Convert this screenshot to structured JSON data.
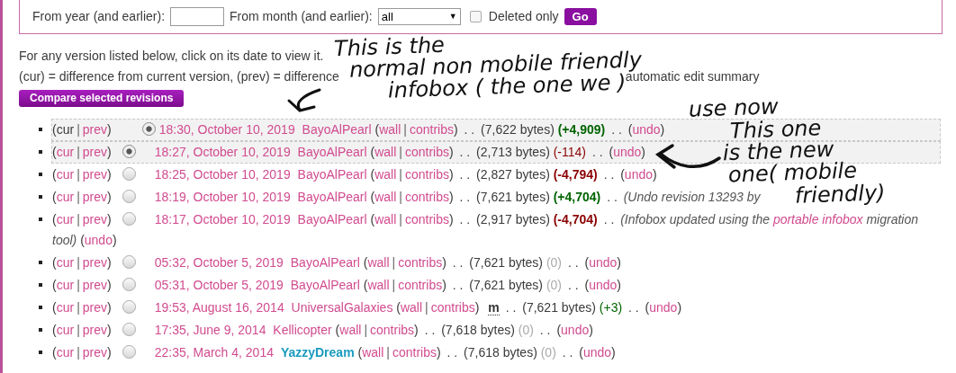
{
  "filter": {
    "year_label": "From year (and earlier):",
    "month_label": "From month (and earlier):",
    "month_value": "all",
    "month_caret": "▼",
    "deleted_label": "Deleted only",
    "deleted_checked": false,
    "go": "Go"
  },
  "intro": "For any version listed below, click on its date to view it.",
  "legend": "(cur) = difference from current version, (prev) = difference",
  "legend_tail": "automatic edit summary",
  "compare_button": "Compare selected revisions",
  "rows": [
    {
      "kind": "current",
      "selected": true,
      "radio_checked": true,
      "before": [
        {
          "text": "(",
          "kind": "open"
        },
        {
          "text": "cur",
          "kind": "plain"
        },
        {
          "text": "|",
          "kind": "sep"
        },
        {
          "text": "prev",
          "kind": "link"
        },
        {
          "text": ")",
          "kind": "close"
        }
      ],
      "after": [
        {
          "text": "18:30, October 10, 2019",
          "kind": "date"
        },
        {
          "text": "BayoAlPearl",
          "kind": "user"
        },
        {
          "text": "(",
          "kind": "open"
        },
        {
          "text": "wall",
          "kind": "link"
        },
        {
          "text": "|",
          "kind": "sep"
        },
        {
          "text": "contribs",
          "kind": "link"
        },
        {
          "text": ")",
          "kind": "close"
        },
        {
          "text": ". .",
          "kind": "dots"
        },
        {
          "text": "(7,622 bytes)",
          "kind": "size"
        },
        {
          "text": "(+4,909)",
          "kind": "diff_big_plus"
        },
        {
          "text": ". .",
          "kind": "dots"
        },
        {
          "text": "(",
          "kind": "open"
        },
        {
          "text": "undo",
          "kind": "link"
        },
        {
          "text": ")",
          "kind": "close"
        }
      ]
    },
    {
      "kind": "older",
      "selected": true,
      "radio_checked": true,
      "before": [
        {
          "text": "(",
          "kind": "open"
        },
        {
          "text": "cur",
          "kind": "link"
        },
        {
          "text": "|",
          "kind": "sep"
        },
        {
          "text": "prev",
          "kind": "link"
        },
        {
          "text": ")",
          "kind": "close"
        }
      ],
      "after": [
        {
          "text": "18:27, October 10, 2019",
          "kind": "date"
        },
        {
          "text": "BayoAlPearl",
          "kind": "user"
        },
        {
          "text": "(",
          "kind": "open"
        },
        {
          "text": "wall",
          "kind": "link"
        },
        {
          "text": "|",
          "kind": "sep"
        },
        {
          "text": "contribs",
          "kind": "link"
        },
        {
          "text": ")",
          "kind": "close"
        },
        {
          "text": ". .",
          "kind": "dots"
        },
        {
          "text": "(2,713 bytes)",
          "kind": "size"
        },
        {
          "text": "(-114)",
          "kind": "diff_minus"
        },
        {
          "text": ". .",
          "kind": "dots"
        },
        {
          "text": "(",
          "kind": "open"
        },
        {
          "text": "undo",
          "kind": "link"
        },
        {
          "text": ")",
          "kind": "close"
        }
      ]
    },
    {
      "kind": "older",
      "selected": false,
      "radio_checked": false,
      "before": [
        {
          "text": "(",
          "kind": "open"
        },
        {
          "text": "cur",
          "kind": "link"
        },
        {
          "text": "|",
          "kind": "sep"
        },
        {
          "text": "prev",
          "kind": "link"
        },
        {
          "text": ")",
          "kind": "close"
        }
      ],
      "after": [
        {
          "text": "18:25, October 10, 2019",
          "kind": "date"
        },
        {
          "text": "BayoAlPearl",
          "kind": "user"
        },
        {
          "text": "(",
          "kind": "open"
        },
        {
          "text": "wall",
          "kind": "link"
        },
        {
          "text": "|",
          "kind": "sep"
        },
        {
          "text": "contribs",
          "kind": "link"
        },
        {
          "text": ")",
          "kind": "close"
        },
        {
          "text": ". .",
          "kind": "dots"
        },
        {
          "text": "(2,827 bytes)",
          "kind": "size"
        },
        {
          "text": "(-4,794)",
          "kind": "diff_big_minus"
        },
        {
          "text": ". .",
          "kind": "dots"
        },
        {
          "text": "(",
          "kind": "open"
        },
        {
          "text": "undo",
          "kind": "link"
        },
        {
          "text": ")",
          "kind": "close"
        }
      ]
    },
    {
      "kind": "older",
      "selected": false,
      "radio_checked": false,
      "before": [
        {
          "text": "(",
          "kind": "open"
        },
        {
          "text": "cur",
          "kind": "link"
        },
        {
          "text": "|",
          "kind": "sep"
        },
        {
          "text": "prev",
          "kind": "link"
        },
        {
          "text": ")",
          "kind": "close"
        }
      ],
      "after": [
        {
          "text": "18:19, October 10, 2019",
          "kind": "date"
        },
        {
          "text": "BayoAlPearl",
          "kind": "user"
        },
        {
          "text": "(",
          "kind": "open"
        },
        {
          "text": "wall",
          "kind": "link"
        },
        {
          "text": "|",
          "kind": "sep"
        },
        {
          "text": "contribs",
          "kind": "link"
        },
        {
          "text": ")",
          "kind": "close"
        },
        {
          "text": ". .",
          "kind": "dots"
        },
        {
          "text": "(7,621 bytes)",
          "kind": "size"
        },
        {
          "text": "(+4,704)",
          "kind": "diff_big_plus"
        },
        {
          "text": ". .",
          "kind": "dots"
        },
        {
          "text": "(Undo revision 13293 by",
          "kind": "summary"
        }
      ]
    },
    {
      "kind": "older",
      "selected": false,
      "radio_checked": false,
      "before": [
        {
          "text": "(",
          "kind": "open"
        },
        {
          "text": "cur",
          "kind": "link"
        },
        {
          "text": "|",
          "kind": "sep"
        },
        {
          "text": "prev",
          "kind": "link"
        },
        {
          "text": ")",
          "kind": "close"
        }
      ],
      "after": [
        {
          "text": "18:17, October 10, 2019",
          "kind": "date"
        },
        {
          "text": "BayoAlPearl",
          "kind": "user"
        },
        {
          "text": "(",
          "kind": "open"
        },
        {
          "text": "wall",
          "kind": "link"
        },
        {
          "text": "|",
          "kind": "sep"
        },
        {
          "text": "contribs",
          "kind": "link"
        },
        {
          "text": ")",
          "kind": "close"
        },
        {
          "text": ". .",
          "kind": "dots"
        },
        {
          "text": "(2,917 bytes)",
          "kind": "size"
        },
        {
          "text": "(-4,704)",
          "kind": "diff_big_minus"
        },
        {
          "text": ". .",
          "kind": "dots"
        },
        {
          "text": "(Infobox updated using the",
          "kind": "summary"
        },
        {
          "text": "portable infobox",
          "kind": "summary_link"
        },
        {
          "text": "migration",
          "kind": "summary"
        },
        {
          "text": "tool)",
          "kind": "summary"
        },
        {
          "text": "(",
          "kind": "open"
        },
        {
          "text": "undo",
          "kind": "link"
        },
        {
          "text": ")",
          "kind": "close"
        }
      ]
    },
    {
      "kind": "older",
      "selected": false,
      "radio_checked": false,
      "before": [
        {
          "text": "(",
          "kind": "open"
        },
        {
          "text": "cur",
          "kind": "link"
        },
        {
          "text": "|",
          "kind": "sep"
        },
        {
          "text": "prev",
          "kind": "link"
        },
        {
          "text": ")",
          "kind": "close"
        }
      ],
      "after": [
        {
          "text": "05:32, October 5, 2019",
          "kind": "date"
        },
        {
          "text": "BayoAlPearl",
          "kind": "user"
        },
        {
          "text": "(",
          "kind": "open"
        },
        {
          "text": "wall",
          "kind": "link"
        },
        {
          "text": "|",
          "kind": "sep"
        },
        {
          "text": "contribs",
          "kind": "link"
        },
        {
          "text": ")",
          "kind": "close"
        },
        {
          "text": ". .",
          "kind": "dots"
        },
        {
          "text": "(7,621 bytes)",
          "kind": "size"
        },
        {
          "text": "(0)",
          "kind": "diff_zero"
        },
        {
          "text": ". .",
          "kind": "dots"
        },
        {
          "text": "(",
          "kind": "open"
        },
        {
          "text": "undo",
          "kind": "link"
        },
        {
          "text": ")",
          "kind": "close"
        }
      ]
    },
    {
      "kind": "older",
      "selected": false,
      "radio_checked": false,
      "before": [
        {
          "text": "(",
          "kind": "open"
        },
        {
          "text": "cur",
          "kind": "link"
        },
        {
          "text": "|",
          "kind": "sep"
        },
        {
          "text": "prev",
          "kind": "link"
        },
        {
          "text": ")",
          "kind": "close"
        }
      ],
      "after": [
        {
          "text": "05:31, October 5, 2019",
          "kind": "date"
        },
        {
          "text": "BayoAlPearl",
          "kind": "user"
        },
        {
          "text": "(",
          "kind": "open"
        },
        {
          "text": "wall",
          "kind": "link"
        },
        {
          "text": "|",
          "kind": "sep"
        },
        {
          "text": "contribs",
          "kind": "link"
        },
        {
          "text": ")",
          "kind": "close"
        },
        {
          "text": ". .",
          "kind": "dots"
        },
        {
          "text": "(7,621 bytes)",
          "kind": "size"
        },
        {
          "text": "(0)",
          "kind": "diff_zero"
        },
        {
          "text": ". .",
          "kind": "dots"
        },
        {
          "text": "(",
          "kind": "open"
        },
        {
          "text": "undo",
          "kind": "link"
        },
        {
          "text": ")",
          "kind": "close"
        }
      ]
    },
    {
      "kind": "older",
      "selected": false,
      "radio_checked": false,
      "before": [
        {
          "text": "(",
          "kind": "open"
        },
        {
          "text": "cur",
          "kind": "link"
        },
        {
          "text": "|",
          "kind": "sep"
        },
        {
          "text": "prev",
          "kind": "link"
        },
        {
          "text": ")",
          "kind": "close"
        }
      ],
      "after": [
        {
          "text": "19:53, August 16, 2014",
          "kind": "date"
        },
        {
          "text": "UniversalGalaxies",
          "kind": "user"
        },
        {
          "text": "(",
          "kind": "open"
        },
        {
          "text": "wall",
          "kind": "link"
        },
        {
          "text": "|",
          "kind": "sep"
        },
        {
          "text": "contribs",
          "kind": "link"
        },
        {
          "text": ")",
          "kind": "close"
        },
        {
          "text": "m",
          "kind": "minor"
        },
        {
          "text": ". .",
          "kind": "dots"
        },
        {
          "text": "(7,621 bytes)",
          "kind": "size"
        },
        {
          "text": "(+3)",
          "kind": "diff_plus"
        },
        {
          "text": ". .",
          "kind": "dots"
        },
        {
          "text": "(",
          "kind": "open"
        },
        {
          "text": "undo",
          "kind": "link"
        },
        {
          "text": ")",
          "kind": "close"
        }
      ]
    },
    {
      "kind": "older",
      "selected": false,
      "radio_checked": false,
      "before": [
        {
          "text": "(",
          "kind": "open"
        },
        {
          "text": "cur",
          "kind": "link"
        },
        {
          "text": "|",
          "kind": "sep"
        },
        {
          "text": "prev",
          "kind": "link"
        },
        {
          "text": ")",
          "kind": "close"
        }
      ],
      "after": [
        {
          "text": "17:35, June 9, 2014",
          "kind": "date"
        },
        {
          "text": "Kellicopter",
          "kind": "user"
        },
        {
          "text": "(",
          "kind": "open"
        },
        {
          "text": "wall",
          "kind": "link"
        },
        {
          "text": "|",
          "kind": "sep"
        },
        {
          "text": "contribs",
          "kind": "link"
        },
        {
          "text": ")",
          "kind": "close"
        },
        {
          "text": ". .",
          "kind": "dots"
        },
        {
          "text": "(7,618 bytes)",
          "kind": "size"
        },
        {
          "text": "(0)",
          "kind": "diff_zero"
        },
        {
          "text": ". .",
          "kind": "dots"
        },
        {
          "text": "(",
          "kind": "open"
        },
        {
          "text": "undo",
          "kind": "link"
        },
        {
          "text": ")",
          "kind": "close"
        }
      ]
    },
    {
      "kind": "older",
      "selected": false,
      "radio_checked": false,
      "before": [
        {
          "text": "(",
          "kind": "open"
        },
        {
          "text": "cur",
          "kind": "link"
        },
        {
          "text": "|",
          "kind": "sep"
        },
        {
          "text": "prev",
          "kind": "link"
        },
        {
          "text": ")",
          "kind": "close"
        }
      ],
      "after": [
        {
          "text": "22:35, March 4, 2014",
          "kind": "date"
        },
        {
          "text": "YazzyDream",
          "kind": "user_staff"
        },
        {
          "text": "(",
          "kind": "open"
        },
        {
          "text": "wall",
          "kind": "link"
        },
        {
          "text": "|",
          "kind": "sep"
        },
        {
          "text": "contribs",
          "kind": "link"
        },
        {
          "text": ")",
          "kind": "close"
        },
        {
          "text": ". .",
          "kind": "dots"
        },
        {
          "text": "(7,618 bytes)",
          "kind": "size"
        },
        {
          "text": "(0)",
          "kind": "diff_zero"
        },
        {
          "text": ". .",
          "kind": "dots"
        },
        {
          "text": "(",
          "kind": "open"
        },
        {
          "text": "undo",
          "kind": "link"
        },
        {
          "text": ")",
          "kind": "close"
        }
      ]
    }
  ],
  "annotations": [
    {
      "lines": [
        "This is the",
        "normal non mobile friendly",
        "infobox ( the one we )",
        "use now"
      ]
    },
    {
      "lines": [
        "This one",
        "is the new",
        "one( mobile",
        "friendly)"
      ]
    }
  ]
}
